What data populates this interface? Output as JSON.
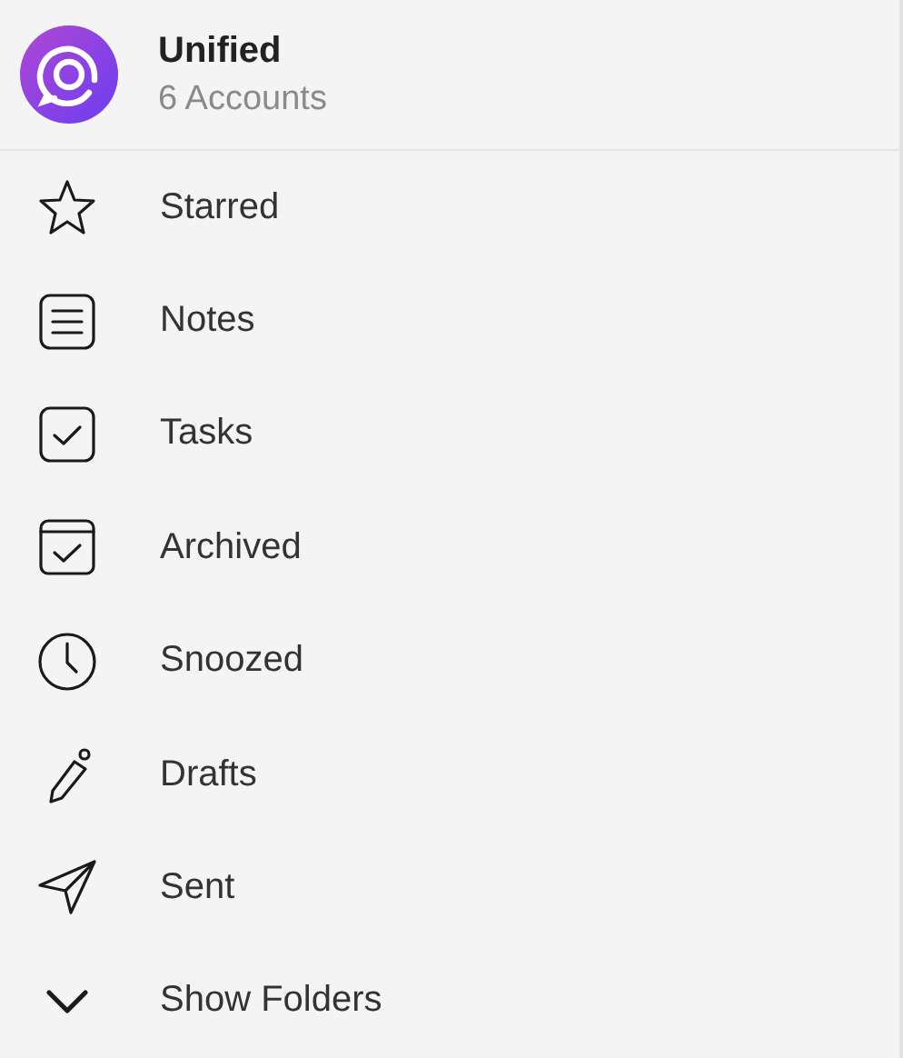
{
  "account": {
    "title": "Unified",
    "subtitle": "6 Accounts"
  },
  "items": [
    {
      "kind": "star",
      "label": "Starred"
    },
    {
      "kind": "notes",
      "label": "Notes"
    },
    {
      "kind": "tasks",
      "label": "Tasks"
    },
    {
      "kind": "archive",
      "label": "Archived"
    },
    {
      "kind": "clock",
      "label": "Snoozed"
    },
    {
      "kind": "pencil",
      "label": "Drafts"
    },
    {
      "kind": "send",
      "label": "Sent"
    },
    {
      "kind": "chevron",
      "label": "Show Folders"
    }
  ]
}
